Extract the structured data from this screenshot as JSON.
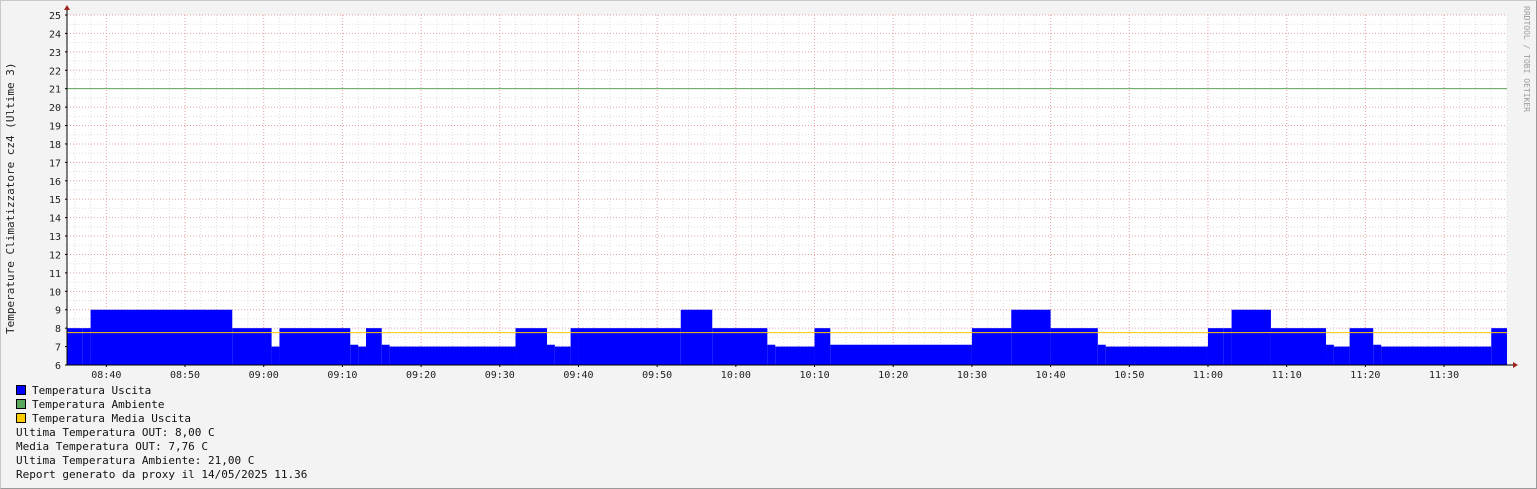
{
  "chart_data": {
    "type": "area",
    "ylabel": "Temperature Climatizzatore cz4 (Ultime 3)",
    "watermark": "RRDTOOL / TOBI OETIKER",
    "ylim": [
      6,
      25
    ],
    "yticks": [
      6,
      7,
      8,
      9,
      10,
      11,
      12,
      13,
      14,
      15,
      16,
      17,
      18,
      19,
      20,
      21,
      22,
      23,
      24,
      25
    ],
    "xlim": [
      "08:35",
      "11:38"
    ],
    "xticks": [
      "08:40",
      "08:50",
      "09:00",
      "09:10",
      "09:20",
      "09:30",
      "09:40",
      "09:50",
      "10:00",
      "10:10",
      "10:20",
      "10:30",
      "10:40",
      "10:50",
      "11:00",
      "11:10",
      "11:20",
      "11:30"
    ],
    "grid": true,
    "legend_position": "bottom-left",
    "colors": {
      "uscita": "#0000ff",
      "ambiente": "#5ca85c",
      "media": "#ffcc00"
    },
    "series": [
      {
        "name": "Temperatura Uscita",
        "style": "area-step",
        "x": [
          "08:35",
          "08:37",
          "08:38",
          "08:56",
          "09:01",
          "09:02",
          "09:11",
          "09:12",
          "09:13",
          "09:15",
          "09:16",
          "09:32",
          "09:36",
          "09:37",
          "09:39",
          "09:40",
          "09:53",
          "09:57",
          "10:04",
          "10:05",
          "10:10",
          "10:12",
          "10:30",
          "10:35",
          "10:40",
          "10:46",
          "10:47",
          "11:00",
          "11:02",
          "11:03",
          "11:08",
          "11:15",
          "11:16",
          "11:18",
          "11:21",
          "11:22",
          "11:36",
          "11:38"
        ],
        "values": [
          8,
          8,
          9,
          8,
          7,
          8,
          7.1,
          7,
          8,
          7.1,
          7,
          8,
          7.1,
          7,
          8,
          8,
          9,
          8,
          7.1,
          7,
          8,
          7.1,
          8,
          9,
          8,
          7.1,
          7,
          8,
          8,
          9,
          8,
          7.1,
          7,
          8,
          7.1,
          7,
          8,
          8
        ]
      },
      {
        "name": "Temperatura Ambiente",
        "style": "line",
        "value": 21
      },
      {
        "name": "Temperatura Media Uscita",
        "style": "line",
        "value": 7.76
      }
    ]
  },
  "legend": [
    {
      "label": "Temperatura Uscita",
      "color": "#0000ff"
    },
    {
      "label": "Temperatura Ambiente",
      "color": "#5ca85c"
    },
    {
      "label": "Temperatura Media Uscita",
      "color": "#ffcc00"
    }
  ],
  "stats": {
    "last_out": "Ultima Temperatura OUT: 8,00 C",
    "avg_out": "Media Temperatura OUT: 7,76 C",
    "last_amb": "Ultima Temperatura Ambiente: 21,00 C",
    "report": "Report generato da proxy il 14/05/2025 11.36"
  }
}
